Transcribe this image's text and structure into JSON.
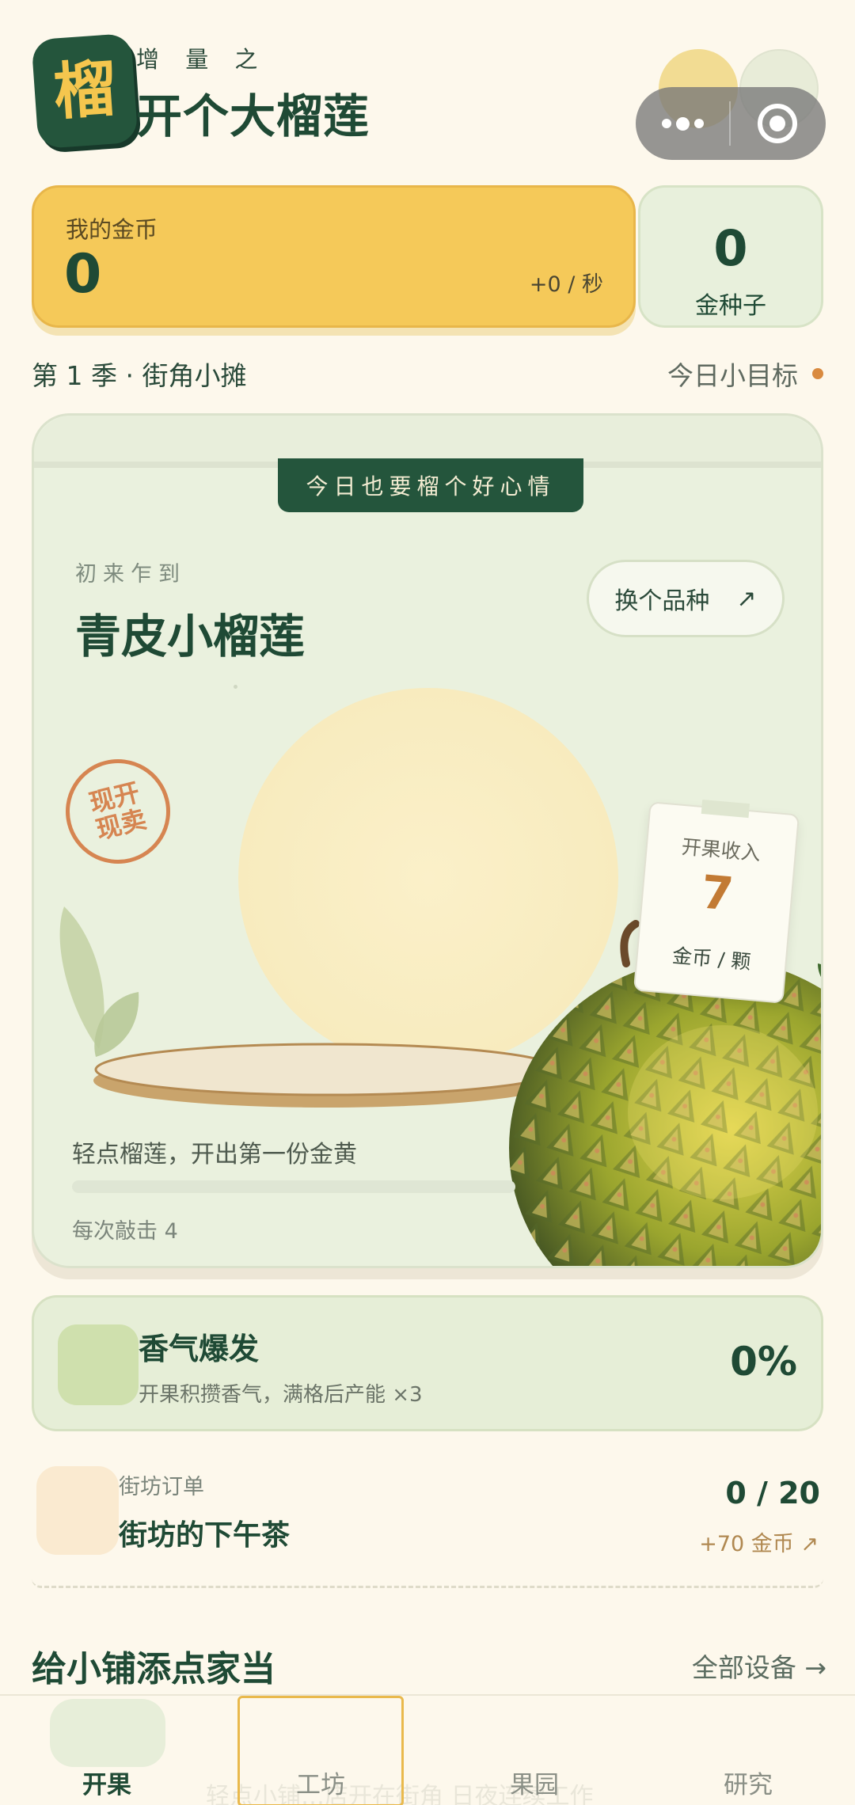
{
  "header": {
    "logo_char": "榴",
    "subtitle": "增 量 之",
    "title": "开个大榴莲"
  },
  "wallet": {
    "coin_label": "我的金币",
    "coin_value": "0",
    "coin_rate": "+0 / 秒",
    "seed_value": "0",
    "seed_label": "金种子"
  },
  "season": "第 1 季 · 街角小摊",
  "daily_goal": "今日小目标",
  "main_card": {
    "ribbon": "今日也要榴个好心情",
    "tier": "初来乍到",
    "variety": "青皮小榴莲",
    "switch_label": "换个品种",
    "switch_icon": "↗",
    "stamp_line1": "现开",
    "stamp_line2": "现卖",
    "price_label": "开果收入",
    "price_value": "7",
    "price_unit": "金币 / 颗",
    "hint": "轻点榴莲，开出第一份金黄",
    "per_tap": "每次敲击 4",
    "progress": 0.0
  },
  "aroma": {
    "title": "香气爆发",
    "desc": "开果积攒香气，满格后产能 ×3",
    "percent": "0%"
  },
  "order": {
    "kicker": "街坊订单",
    "title": "街坊的下午茶",
    "progress": "0 / 20",
    "reward": "+70 金币 ↗"
  },
  "equipment": {
    "title": "给小铺添点家当",
    "link": "全部设备 →"
  },
  "tabs": [
    {
      "label": "开果"
    },
    {
      "label": "工坊"
    },
    {
      "label": "果园"
    },
    {
      "label": "研究"
    }
  ],
  "ghost_text": "轻点小铺…店开在街角 日夜连续工作",
  "colors": {
    "brand_green": "#1f4a35",
    "gold": "#f5c959",
    "accent_orange": "#d68551"
  }
}
